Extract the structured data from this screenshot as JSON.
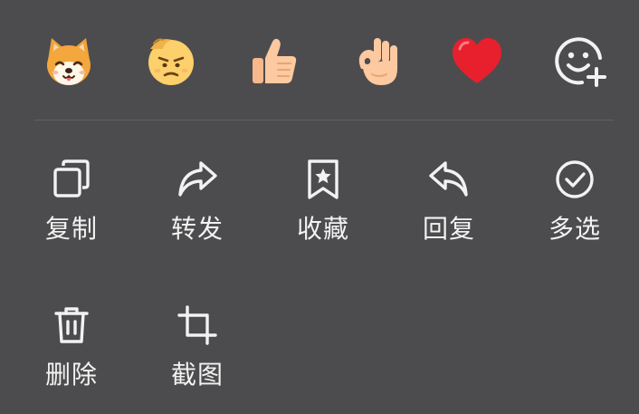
{
  "reactions": [
    {
      "icon": "shiba-dog-emoji-icon"
    },
    {
      "icon": "sweating-face-emoji-icon"
    },
    {
      "icon": "thumbs-up-emoji-icon"
    },
    {
      "icon": "ok-hand-emoji-icon"
    },
    {
      "icon": "red-heart-emoji-icon"
    },
    {
      "icon": "add-emoji-icon"
    }
  ],
  "actions": [
    {
      "label": "复制",
      "icon": "copy-icon"
    },
    {
      "label": "转发",
      "icon": "forward-icon"
    },
    {
      "label": "收藏",
      "icon": "bookmark-icon"
    },
    {
      "label": "回复",
      "icon": "reply-icon"
    },
    {
      "label": "多选",
      "icon": "check-circle-icon"
    },
    {
      "label": "删除",
      "icon": "trash-icon"
    },
    {
      "label": "截图",
      "icon": "crop-icon"
    }
  ],
  "colors": {
    "background": "#4c4c4e",
    "icon_stroke": "#f2f2f2",
    "heart": "#e8202e",
    "emoji_skin": "#fcd06b"
  }
}
